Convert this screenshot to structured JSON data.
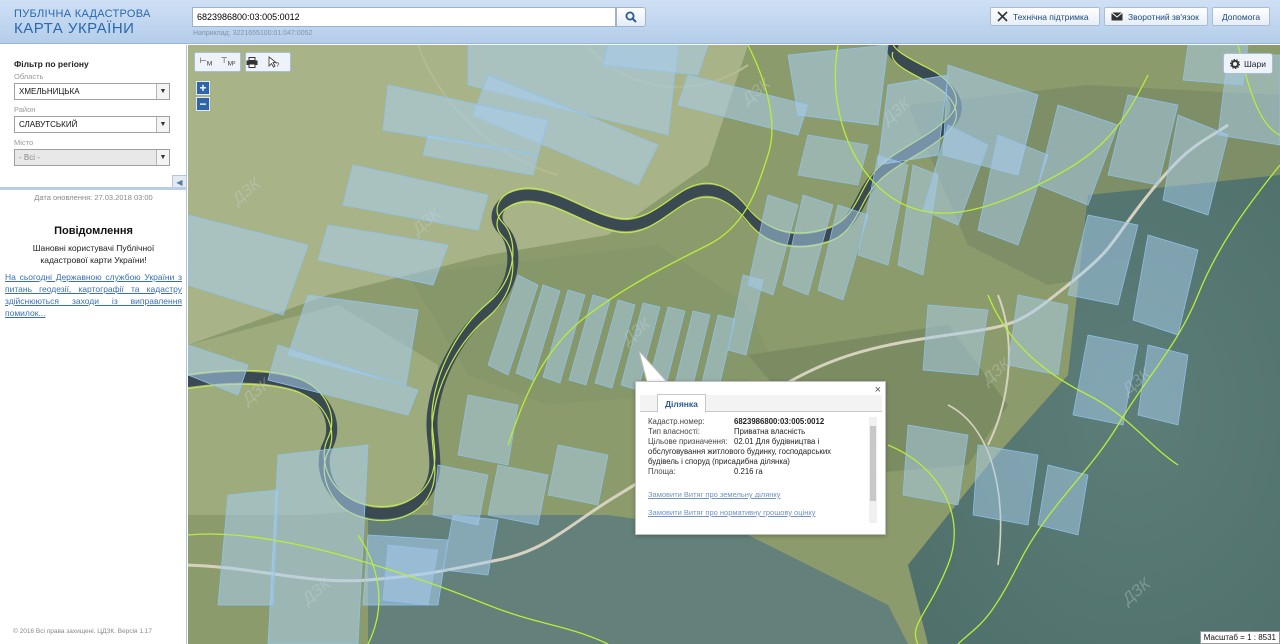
{
  "header": {
    "logo_line1": "ПУБЛІЧНА КАДАСТРОВА",
    "logo_line2": "КАРТА УКРАЇНИ",
    "search_value": "6823986800:03:005:0012",
    "search_example": "Наприклад: 3221655100:01:047:0052",
    "buttons": {
      "support": "Технічна підтримка",
      "feedback": "Зворотний зв'язок",
      "help": "Допомога"
    }
  },
  "sidebar": {
    "filter_title": "Фільтр по регіону",
    "region_label": "Область",
    "region_value": "ХМЕЛЬНИЦЬКА",
    "district_label": "Район",
    "district_value": "СЛАВУТСЬКИЙ",
    "city_label": "Місто",
    "city_value": "- Всі -",
    "update_date": "Дата оновлення: 27.03.2018 03:00",
    "notice_title": "Повідомлення",
    "notice_greeting": "Шановні користувачі Публічної кадастрової карти України!",
    "notice_link": "На сьогодні Державною службою України з питань геодезії, картографії та кадастру здійснюються заходи із виправлення помилок...",
    "copyright": "© 2016 Всі права захищені. ЦДЗК. Версія 1.17"
  },
  "map": {
    "tools": {
      "length": "М",
      "area": "М²"
    },
    "zoom_in": "+",
    "zoom_out": "−",
    "layers_label": "Шари",
    "scale": "Масштаб = 1 : 8531"
  },
  "popup": {
    "tab": "Ділянка",
    "fields": [
      {
        "key": "Кадастр.номер:",
        "value": "6823986800:03:005:0012"
      },
      {
        "key": "Тип власності:",
        "value": "Приватна власність"
      },
      {
        "key": "Цільове призначення:",
        "value": "02.01 Для будівництва і обслуговування житлового будинку, господарських будівель і споруд (присадибна ділянка)"
      },
      {
        "key": "Площа:",
        "value": "0.216 га"
      }
    ],
    "link_extract": "Замовити Витяг про земельну ділянку",
    "link_valuation": "Замовити Витяг про нормативну грошову оцінку",
    "close": "×"
  },
  "colors": {
    "header_bg": "#bcd3ee",
    "logo": "#2a68b0",
    "parcel": "#9ec8ee",
    "boundary": "#b8ee3a",
    "river": "#3a4a56"
  },
  "icons": [
    "search-icon",
    "tools-icon",
    "envelope-icon",
    "print-icon",
    "cursor-help-icon",
    "gear-icon",
    "close-icon"
  ]
}
